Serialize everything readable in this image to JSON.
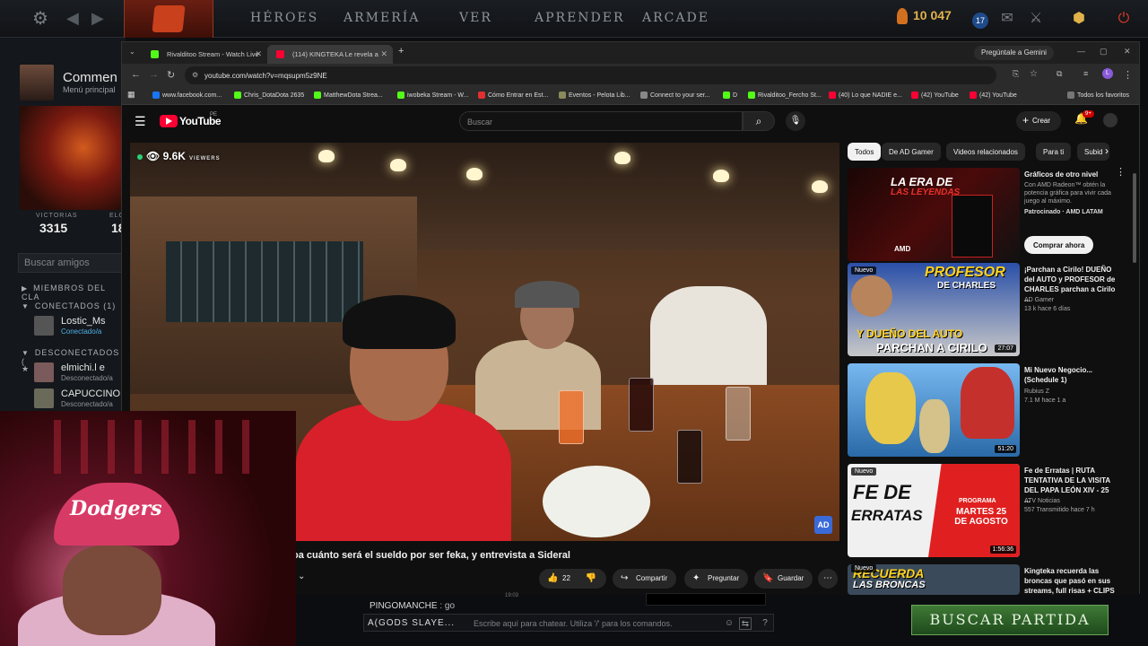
{
  "dota": {
    "nav": [
      "HÉROES",
      "ARMERÍA",
      "VER",
      "APRENDER",
      "ARCADE"
    ],
    "gold": "10 047",
    "level": "17",
    "profile_name": "Commen",
    "profile_sub": "Menú principal",
    "wins_label": "VICTORIAS",
    "wins_value": "3315",
    "elo_label": "ELO",
    "elo_value": "18",
    "friend_search_placeholder": "Buscar amigos",
    "clan_section": "MIEMBROS DEL CLA",
    "online_section": "CONECTADOS (1)",
    "offline_section": "DESCONECTADOS (",
    "friends": [
      {
        "name": "Lostic_Ms",
        "status": "Conectado/a"
      },
      {
        "name": "elmichi.l e",
        "status": "Desconectado/a"
      },
      {
        "name": "CAPUCCINO",
        "status": "Desconectado/a"
      }
    ],
    "chat_line_user": "PINGOMANCHE",
    "chat_line_text": ": go",
    "chat_time": "19:03",
    "chat_user": "A(GODS SLAYE...",
    "chat_placeholder": "Escribe aquí para chatear. Utiliza '/' para los comandos.",
    "find_match": "BUSCAR PARTIDA"
  },
  "webcam": {
    "cap_text": "Dodgers"
  },
  "browser": {
    "tabs": [
      {
        "title": "Rivalditoo Stream - Watch Live",
        "color": "#53fc18"
      },
      {
        "title": "(114) KINGTEKA Le revela a",
        "color": "#ff0033"
      }
    ],
    "gemini": "Pregúntale a Gemini",
    "url": "youtube.com/watch?v=mqsupm5z9NE",
    "bookmarks": [
      {
        "label": "www.facebook.com...",
        "color": "#1877f2"
      },
      {
        "label": "Chris_DotaDota 2635",
        "color": "#53fc18"
      },
      {
        "label": "MatthewDota Strea...",
        "color": "#53fc18"
      },
      {
        "label": "iwobeka Stream - W...",
        "color": "#53fc18"
      },
      {
        "label": "Cómo Entrar en Est...",
        "color": "#e03030"
      },
      {
        "label": "Eventos - Pelota Lib...",
        "color": "#8a8a5a"
      },
      {
        "label": "Connect to your ser...",
        "color": "#888888"
      },
      {
        "label": "D",
        "color": "#53fc18"
      },
      {
        "label": "Rivalditoo_Fercho St...",
        "color": "#53fc18"
      },
      {
        "label": "(40) Lo que NADIE e...",
        "color": "#ff0033"
      },
      {
        "label": "(42) YouTube",
        "color": "#ff0033"
      },
      {
        "label": "(42) YouTube",
        "color": "#ff0033"
      }
    ],
    "all_bookmarks": "Todos los favoritos"
  },
  "youtube": {
    "brand": "YouTube",
    "region": "PE",
    "search_placeholder": "Buscar",
    "create": "Crear",
    "notif_count": "9+",
    "viewers": "9.6K",
    "viewers_label": "VIEWERS",
    "video_watermark": "AD",
    "video_title": "oa cuánto será el sueldo por ser feka, y entrevista a Sideral",
    "likes": "22",
    "share": "Compartir",
    "ask": "Preguntar",
    "save": "Guardar",
    "chips": [
      "Todos",
      "De AD Gamer",
      "Videos relacionados",
      "Para ti",
      "Subid"
    ],
    "recs": [
      {
        "title": "Gráficos de otro nivel",
        "desc": "Con AMD Radeon™ obtén la potencia gráfica para vivir cada juego al máximo.",
        "channel": "Patrocinado · AMD LATAM",
        "cta": "Comprar ahora",
        "thumb_t1": "LA ERA DE",
        "thumb_t2": "LAS LEYENDAS",
        "thumb_brand": "AMD"
      },
      {
        "title": "¡Parchan a Cirilo! DUEÑO del AUTO y PROFESOR de CHARLES parchan a Cirilo ...",
        "channel": "AD Gamer",
        "meta": "13 k  hace 6 días",
        "duration": "27:07",
        "badge": "Nuevo",
        "thumb_a": "PROFESOR",
        "thumb_b": "DE CHARLES",
        "thumb_c": "Y DUEÑO DEL AUTO",
        "thumb_d": "PARCHAN A CIRILO"
      },
      {
        "title": "Mi Nuevo Negocio... (Schedule 1)",
        "channel": "Rubius Z",
        "meta": "7.1 M  hace 1 a",
        "duration": "51:20"
      },
      {
        "title": "Fe de Erratas | RUTA TENTATIVA DE LA VISITA DEL PAPA LEÓN XIV - 25 ...",
        "channel": "ATV Noticias",
        "meta": "557  Transmitido hace 7 h",
        "duration": "1:56:36",
        "badge": "Nuevo",
        "thumb_fe": "FE DE",
        "thumb_err": "ERRATAS",
        "thumb_prog": "PROGRAMA",
        "thumb_date": "MARTES 25 DE AGOSTO"
      },
      {
        "title": "Kingteka recuerda las broncas que pasó en sus streams, full risas + CLIPS",
        "badge": "Nuevo",
        "thumb_t": "RECUERDA",
        "thumb_t2": "LAS BRONCAS"
      }
    ]
  }
}
